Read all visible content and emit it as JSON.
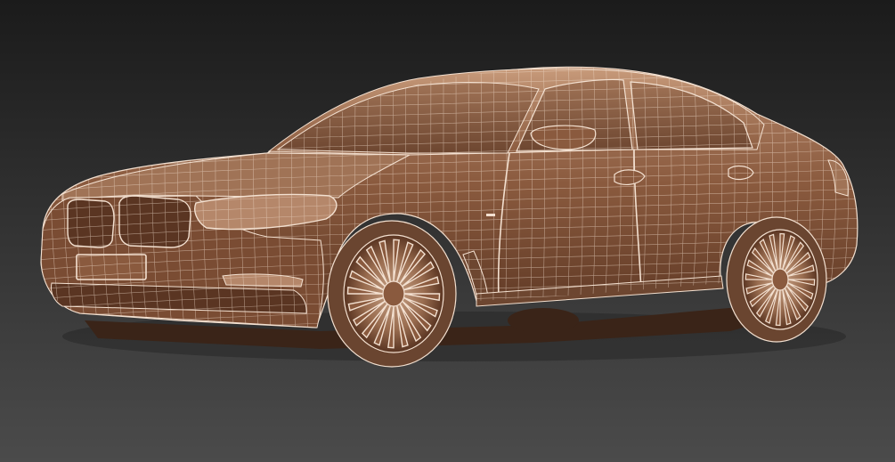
{
  "viewport": {
    "background_top": "#1b1b1b",
    "background_bottom": "#4b4b4b"
  },
  "model": {
    "subject": "sedan-wireframe",
    "shading": "clay-wireframe",
    "body_color": "#8a5a3e",
    "body_highlight": "#c79a7a",
    "body_shadow": "#4a2a18",
    "wire_color": "#f3e0d0",
    "tire_color": "#6a4530",
    "undercarriage_color": "#3a2418"
  }
}
